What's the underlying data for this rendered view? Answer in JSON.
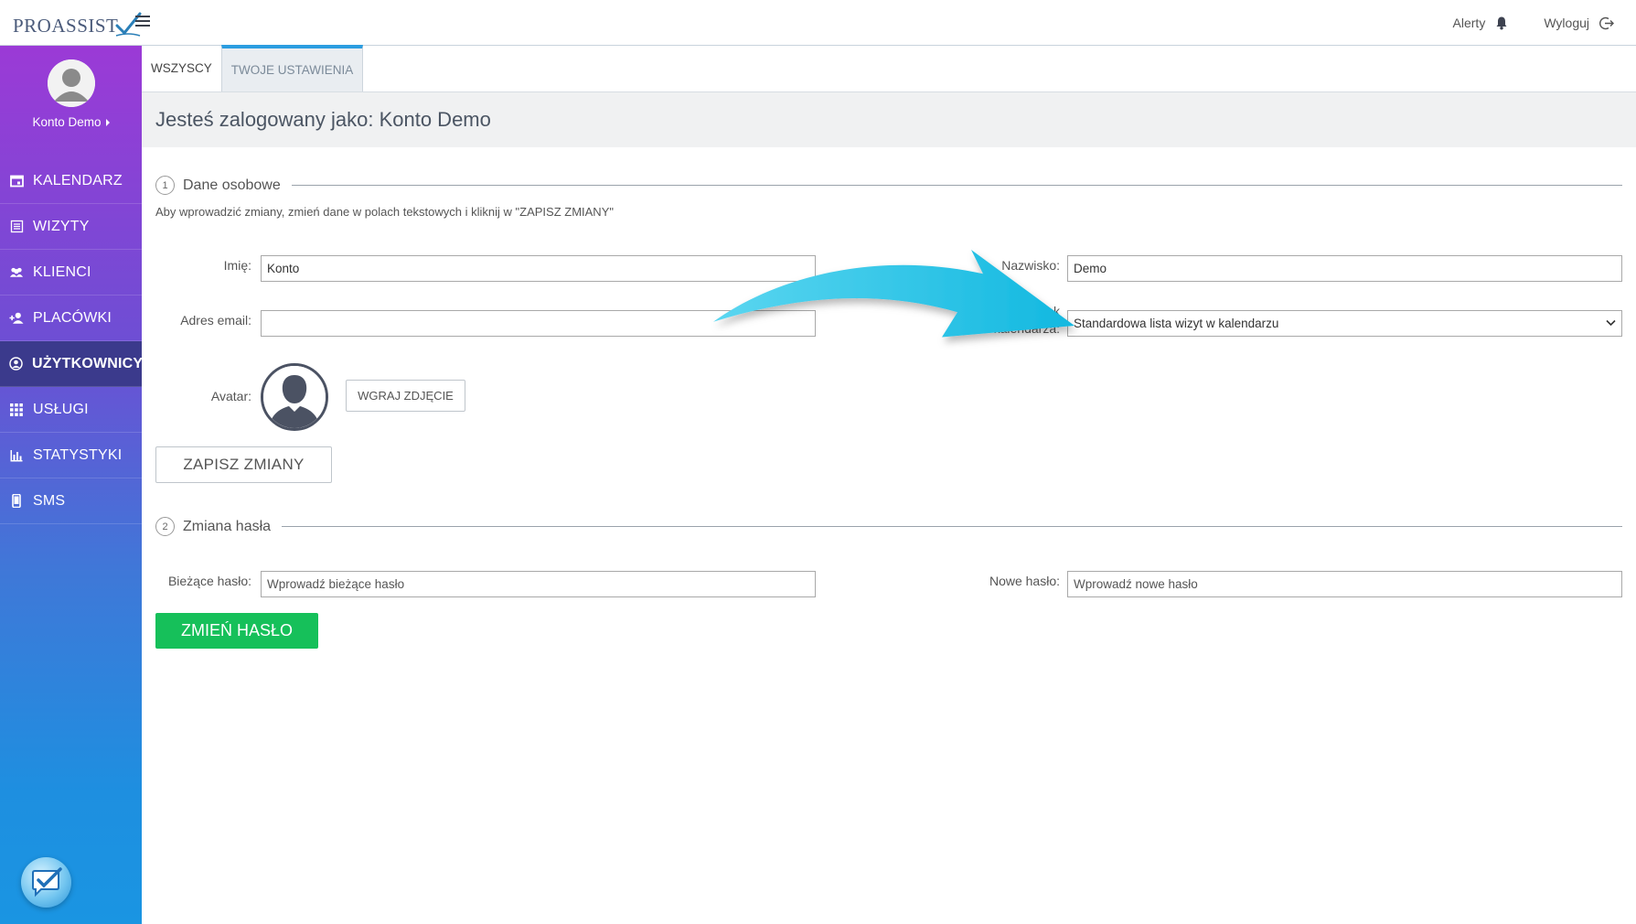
{
  "app": {
    "logo_text": "PROASSIST"
  },
  "header": {
    "alerts_label": "Alerty",
    "logout_label": "Wyloguj"
  },
  "sidebar": {
    "user_name": "Konto Demo",
    "items": [
      {
        "label": "KALENDARZ",
        "icon": "calendar-icon"
      },
      {
        "label": "WIZYTY",
        "icon": "list-icon"
      },
      {
        "label": "KLIENCI",
        "icon": "users-icon"
      },
      {
        "label": "PLACÓWKI",
        "icon": "add-person-icon"
      },
      {
        "label": "UŻYTKOWNICY",
        "icon": "user-circle-icon",
        "active": true
      },
      {
        "label": "USŁUGI",
        "icon": "grid-icon"
      },
      {
        "label": "STATYSTYKI",
        "icon": "bar-chart-icon"
      },
      {
        "label": "SMS",
        "icon": "phone-icon"
      }
    ]
  },
  "tabs": [
    {
      "label": "WSZYSCY"
    },
    {
      "label": "TWOJE USTAWIENIA",
      "active": true
    }
  ],
  "page_title": "Jesteś zalogowany jako: Konto Demo",
  "personal": {
    "number": "1",
    "title": "Dane osobowe",
    "hint": "Aby wprowadzić zmiany, zmień dane w polach tekstowych i kliknij w \"ZAPISZ ZMIANY\"",
    "first_name_label": "Imię:",
    "first_name_value": "Konto",
    "last_name_label": "Nazwisko:",
    "last_name_value": "Demo",
    "email_label": "Adres email:",
    "email_value": "",
    "calendar_view_label_1": "Widok",
    "calendar_view_label_2": "kalendarza:",
    "calendar_view_value": "Standardowa lista wizyt w kalendarzu",
    "avatar_label": "Avatar:",
    "upload_button": "WGRAJ ZDJĘCIE",
    "save_button": "ZAPISZ ZMIANY"
  },
  "password": {
    "number": "2",
    "title": "Zmiana hasła",
    "current_label": "Bieżące hasło:",
    "current_placeholder": "Wprowadź bieżące hasło",
    "new_label": "Nowe hasło:",
    "new_placeholder": "Wprowadź nowe hasło",
    "change_button": "ZMIEŃ HASŁO"
  },
  "colors": {
    "accent_blue": "#2b9de0",
    "green": "#16c05a",
    "sidebar_active": "#3b3a8c",
    "arrow": "#22c3e6"
  }
}
